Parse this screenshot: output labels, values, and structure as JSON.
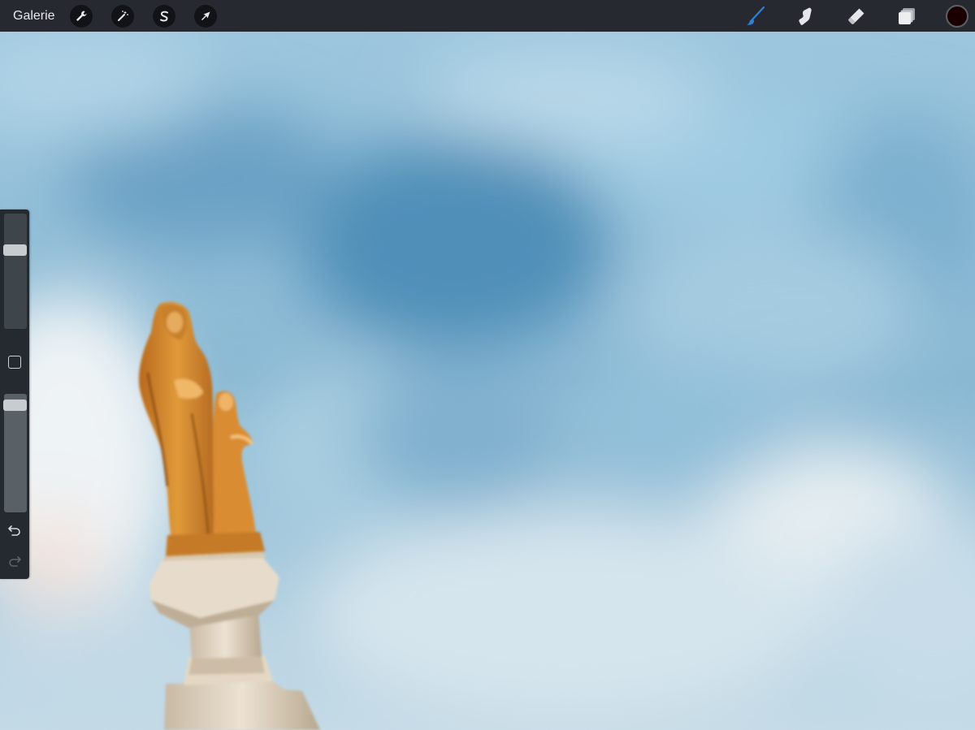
{
  "toolbar": {
    "gallery_label": "Galerie",
    "left_tools": [
      "wrench-icon",
      "magic-wand-icon",
      "selection-s-icon",
      "transform-arrow-icon"
    ],
    "right_tools": [
      "brush-icon",
      "smudge-icon",
      "eraser-icon",
      "layers-icon"
    ],
    "active_tool": "brush",
    "active_tool_color": "#2f7fd8",
    "current_color": "#1a0000"
  },
  "sidebar": {
    "brush_size_level": 0.7,
    "opacity_level": 0.95
  }
}
